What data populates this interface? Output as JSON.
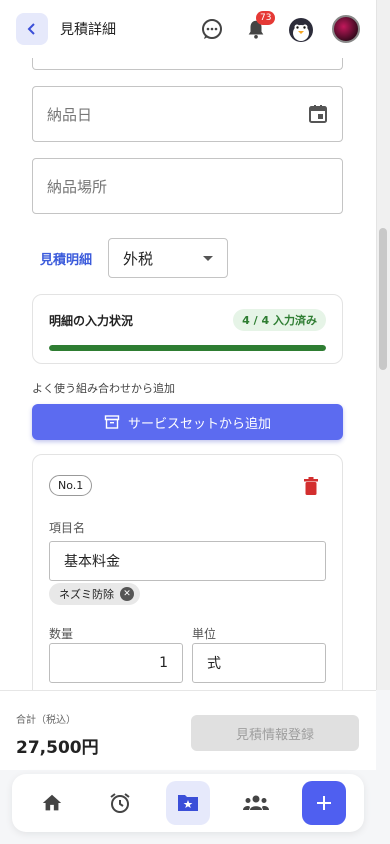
{
  "header": {
    "title": "見積詳細",
    "notification_count": "73"
  },
  "form": {
    "delivery_date_placeholder": "納品日",
    "delivery_place_placeholder": "納品場所"
  },
  "estimate": {
    "label": "見積明細",
    "tax_mode": "外税"
  },
  "status": {
    "title": "明細の入力状況",
    "chip": "4 / 4 入力済み",
    "progress": 1.0
  },
  "combo": {
    "label": "よく使う組み合わせから追加",
    "button": "サービスセットから追加"
  },
  "item": {
    "no": "No.1",
    "name_label": "項目名",
    "name_value": "基本料金",
    "tag": "ネズミ防除",
    "qty_label": "数量",
    "qty_value": "1",
    "unit_label": "単位",
    "unit_value": "式"
  },
  "footer": {
    "total_label": "合計（税込）",
    "total_value": "27,500円",
    "register_button": "見積情報登録"
  },
  "nav": {
    "items": [
      "home-icon",
      "alarm-icon",
      "folder-star-icon",
      "group-icon",
      "add-icon"
    ]
  },
  "colors": {
    "accent": "#5c6bf0",
    "success": "#2e7d32",
    "danger": "#d32f2f"
  }
}
